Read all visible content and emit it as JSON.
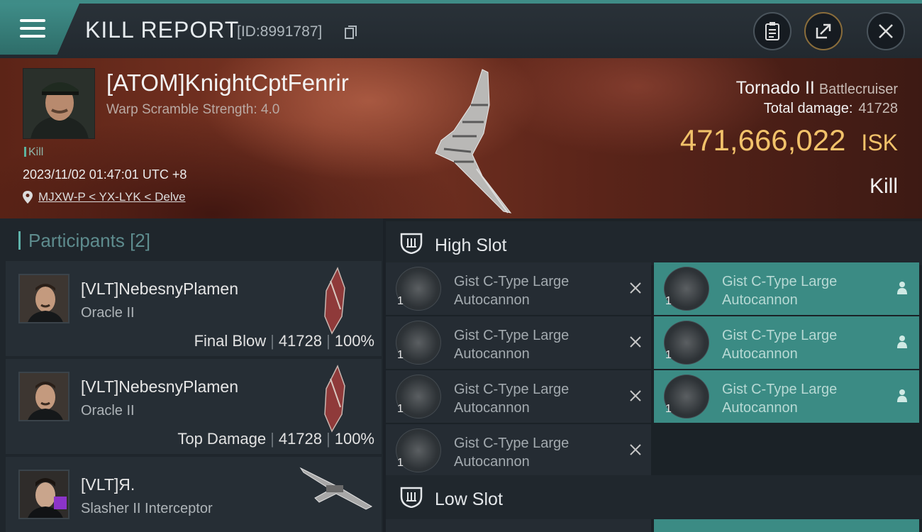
{
  "header": {
    "title": "KILL REPORT",
    "id_text": "[ID:8991787]"
  },
  "victim": {
    "name": "[ATOM]KnightCptFenrir",
    "scramble": "Warp Scramble Strength: 4.0",
    "tag": "Kill",
    "datetime": "2023/11/02 01:47:01 UTC +8",
    "location": "MJXW-P < YX-LYK < Delve",
    "ship_name": "Tornado II",
    "ship_class": "Battlecruiser",
    "damage_label": "Total damage:",
    "damage_value": "41728",
    "isk_value": "471,666,022",
    "isk_unit": "ISK",
    "result": "Kill"
  },
  "participants": {
    "label": "Participants",
    "count": "[2]",
    "items": [
      {
        "name": "[VLT]NebesnyPlamen",
        "ship": "Oracle II",
        "role": "Final Blow",
        "damage": "41728",
        "percent": "100%"
      },
      {
        "name": "[VLT]NebesnyPlamen",
        "ship": "Oracle II",
        "role": "Top Damage",
        "damage": "41728",
        "percent": "100%"
      },
      {
        "name": "[VLT]Я.",
        "ship": "Slasher II Interceptor"
      }
    ]
  },
  "slots": {
    "high_label": "High Slot",
    "low_label": "Low Slot",
    "high_destroyed": [
      {
        "qty": "1",
        "name_line1": "Gist C-Type Large",
        "name_line2": "Autocannon"
      },
      {
        "qty": "1",
        "name_line1": "Gist C-Type Large",
        "name_line2": "Autocannon"
      },
      {
        "qty": "1",
        "name_line1": "Gist C-Type Large",
        "name_line2": "Autocannon"
      },
      {
        "qty": "1",
        "name_line1": "Gist C-Type Large",
        "name_line2": "Autocannon"
      }
    ],
    "high_dropped": [
      {
        "qty": "1",
        "name_line1": "Gist C-Type Large",
        "name_line2": "Autocannon"
      },
      {
        "qty": "1",
        "name_line1": "Gist C-Type Large",
        "name_line2": "Autocannon"
      },
      {
        "qty": "1",
        "name_line1": "Gist C-Type Large",
        "name_line2": "Autocannon"
      }
    ]
  },
  "colors": {
    "accent": "#3f8c87",
    "isk": "#f2c26a",
    "dropped_bg": "#3b8b84"
  },
  "icons": [
    "menu-icon",
    "copy-icon",
    "clipboard-icon",
    "share-icon",
    "close-icon",
    "location-pin-icon",
    "shield-icon",
    "x-icon",
    "person-icon"
  ]
}
